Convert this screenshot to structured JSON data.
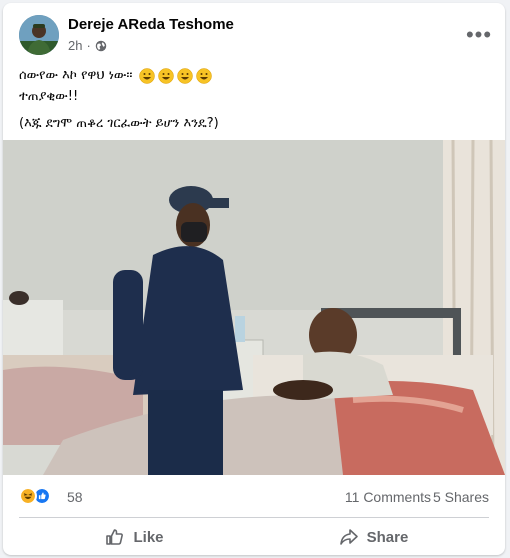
{
  "post": {
    "author": "Dereje AReda Teshome",
    "time": "2h",
    "separator": "·",
    "privacy_icon": "globe-icon",
    "more_icon": "more-options-icon",
    "more_glyph": "•••",
    "text_lines": [
      "ሰውየው እኮ የዋህ ነው፡፡",
      "ተጠያቂው!!",
      "(እጁ ደግሞ ጠቆረ ገርፈውት ይሆን እንዴ?)"
    ],
    "emojis": [
      "grinning-face-icon",
      "grinning-face-icon",
      "grinning-face-icon",
      "grinning-face-icon"
    ],
    "photo": "hospital-visit-photo"
  },
  "stats": {
    "reactions": [
      "haha-reaction-icon",
      "like-reaction-icon"
    ],
    "reaction_count": "58",
    "comments": "11 Comments",
    "shares": "5 Shares"
  },
  "actions": {
    "like_label": "Like",
    "share_label": "Share"
  },
  "colors": {
    "like_blue": "#1877f2",
    "haha_yellow": "#f7b125",
    "text_secondary": "#65676b",
    "card_bg": "#ffffff",
    "page_bg": "#f0f2f5"
  }
}
